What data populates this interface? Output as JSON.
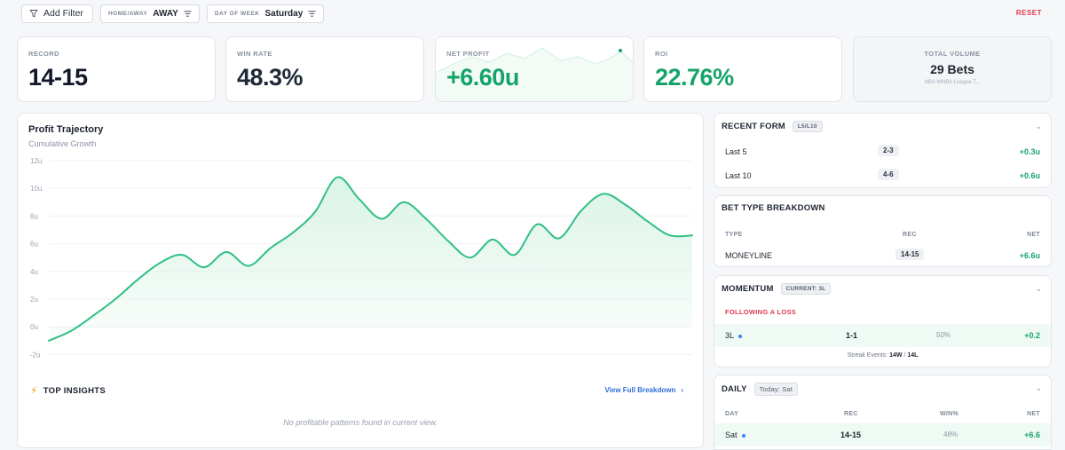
{
  "filters": {
    "add_filter_label": "Add Filter",
    "home_away": {
      "label": "HOME/AWAY",
      "value": "AWAY"
    },
    "day_of_week": {
      "label": "DAY OF WEEK",
      "value": "Saturday"
    },
    "reset_label": "RESET"
  },
  "kpis": {
    "record": {
      "label": "RECORD",
      "value": "14-15"
    },
    "win_rate": {
      "label": "WIN RATE",
      "value": "48.3%"
    },
    "net_profit": {
      "label": "NET PROFIT",
      "value": "+6.60u"
    },
    "roi": {
      "label": "ROI",
      "value": "22.76%"
    },
    "total_volume": {
      "label": "TOTAL VOLUME",
      "value": "29 Bets",
      "sub": "NBA WNBA League T..."
    }
  },
  "profit_chart": {
    "title": "Profit Trajectory",
    "subtitle": "Cumulative Growth"
  },
  "chart_data": {
    "type": "area",
    "title": "Profit Trajectory",
    "subtitle": "Cumulative Growth",
    "y_ticks": [
      "12u",
      "10u",
      "8u",
      "6u",
      "4u",
      "2u",
      "0u",
      "-2u"
    ],
    "y_tick_values": [
      12,
      10,
      8,
      6,
      4,
      2,
      0,
      -2
    ],
    "ylim": [
      -2,
      12
    ],
    "grid": true,
    "line_color": "#2fbf83",
    "fill_color": "#d9f3e6",
    "x": [
      0,
      1,
      2,
      3,
      4,
      5,
      6,
      7,
      8,
      9,
      10,
      11,
      12,
      13,
      14,
      15,
      16,
      17,
      18,
      19,
      20,
      21,
      22,
      23,
      24,
      25,
      26,
      27,
      28,
      29
    ],
    "series": [
      {
        "values": [
          -1,
          -0.3,
          0.8,
          2,
          3.4,
          4.6,
          5.2,
          4.3,
          5.4,
          4.4,
          5.7,
          6.8,
          8.3,
          10.8,
          9.2,
          7.8,
          9,
          7.8,
          6.2,
          5,
          6.3,
          5.2,
          7.4,
          6.4,
          8.4,
          9.6,
          8.8,
          7.6,
          6.6,
          6.6
        ]
      }
    ]
  },
  "insights": {
    "title": "TOP INSIGHTS",
    "view_full_label": "View Full Breakdown",
    "empty_text": "No profitable patterns found in current view."
  },
  "recent_form": {
    "title": "RECENT FORM",
    "tag": "L5/L10",
    "rows": [
      {
        "label": "Last 5",
        "record": "2-3",
        "net": "+0.3u"
      },
      {
        "label": "Last 10",
        "record": "4-6",
        "net": "+0.6u"
      }
    ]
  },
  "bet_type": {
    "title": "BET TYPE BREAKDOWN",
    "columns": {
      "type": "TYPE",
      "rec": "REC",
      "net": "NET"
    },
    "rows": [
      {
        "type": "MONEYLINE",
        "rec": "14-15",
        "net": "+6.6u"
      }
    ]
  },
  "momentum": {
    "title": "MOMENTUM",
    "tag": "CURRENT: 3L",
    "following_label": "FOLLOWING A LOSS",
    "row": {
      "label": "3L",
      "record": "1-1",
      "pct": "50%",
      "net": "+0.2"
    },
    "streak_prefix": "Streak Events:",
    "streak_w": "14W",
    "streak_sep": "/",
    "streak_l": "14L"
  },
  "daily": {
    "title": "DAILY",
    "tag": "Today: Sat",
    "columns": {
      "day": "DAY",
      "rec": "REC",
      "win": "WIN%",
      "net": "NET"
    },
    "row": {
      "day": "Sat",
      "rec": "14-15",
      "win": "48%",
      "net": "+6.6"
    }
  },
  "colors": {
    "accent_green": "#16a36a",
    "accent_red": "#e0384d",
    "link_blue": "#2f6fd8"
  }
}
